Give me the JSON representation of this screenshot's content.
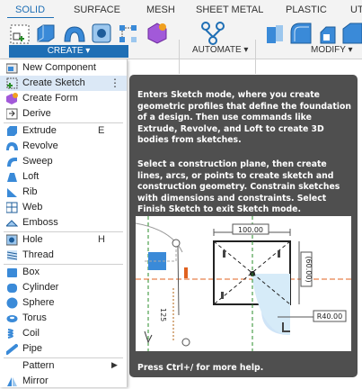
{
  "ribbon": {
    "tabs": [
      "SOLID",
      "SURFACE",
      "MESH",
      "SHEET METAL",
      "PLASTIC",
      "UTI"
    ],
    "groups": {
      "create": "CREATE ▾",
      "automate": "AUTOMATE ▾",
      "modify": "MODIFY ▾"
    },
    "accent_color": "#1f6fb5"
  },
  "menu": {
    "items": [
      {
        "label": "New Component",
        "shortcut": "",
        "icon": "new-component-icon"
      },
      {
        "label": "Create Sketch",
        "shortcut": "",
        "icon": "create-sketch-icon",
        "highlighted": true,
        "more": "⋮"
      },
      {
        "label": "Create Form",
        "shortcut": "",
        "icon": "create-form-icon"
      },
      {
        "label": "Derive",
        "shortcut": "",
        "icon": "derive-icon"
      },
      {
        "label": "Extrude",
        "shortcut": "E",
        "icon": "extrude-icon"
      },
      {
        "label": "Revolve",
        "shortcut": "",
        "icon": "revolve-icon"
      },
      {
        "label": "Sweep",
        "shortcut": "",
        "icon": "sweep-icon"
      },
      {
        "label": "Loft",
        "shortcut": "",
        "icon": "loft-icon"
      },
      {
        "label": "Rib",
        "shortcut": "",
        "icon": "rib-icon"
      },
      {
        "label": "Web",
        "shortcut": "",
        "icon": "web-icon"
      },
      {
        "label": "Emboss",
        "shortcut": "",
        "icon": "emboss-icon"
      },
      {
        "label": "Hole",
        "shortcut": "H",
        "icon": "hole-icon"
      },
      {
        "label": "Thread",
        "shortcut": "",
        "icon": "thread-icon"
      },
      {
        "label": "Box",
        "shortcut": "",
        "icon": "box-icon"
      },
      {
        "label": "Cylinder",
        "shortcut": "",
        "icon": "cylinder-icon"
      },
      {
        "label": "Sphere",
        "shortcut": "",
        "icon": "sphere-icon"
      },
      {
        "label": "Torus",
        "shortcut": "",
        "icon": "torus-icon"
      },
      {
        "label": "Coil",
        "shortcut": "",
        "icon": "coil-icon"
      },
      {
        "label": "Pipe",
        "shortcut": "",
        "icon": "pipe-icon"
      },
      {
        "label": "Pattern",
        "shortcut": "",
        "icon": "",
        "submenu": "▶"
      },
      {
        "label": "Mirror",
        "shortcut": "",
        "icon": "mirror-icon"
      }
    ]
  },
  "tooltip": {
    "para1": "Enters Sketch mode, where you create geometric profiles that define the foundation of a design. Then use commands like Extrude, Revolve, and Loft to create 3D bodies from sketches.",
    "para2": "Select a construction plane, then create lines, arcs, or points to create sketch and construction geometry. Constrain sketches with dimensions and constraints. Select Finish Sketch to exit Sketch mode.",
    "illustration": {
      "dim_width": "100.00",
      "dim_height": "(60.00)",
      "dim_radius": "R40.00",
      "dim_left": "125"
    },
    "help": "Press Ctrl+/ for more help."
  }
}
